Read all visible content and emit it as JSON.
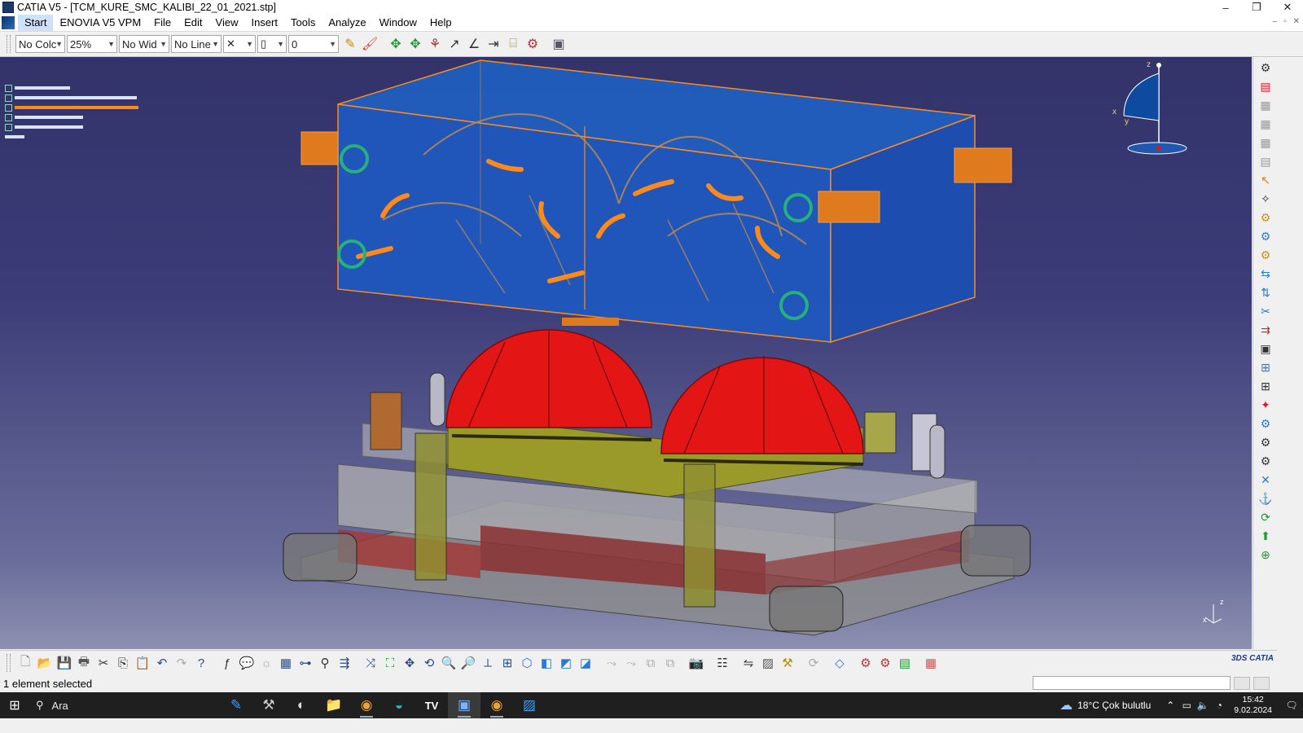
{
  "window": {
    "title": "CATIA V5 - [TCM_KURE_SMC_KALIBI_22_01_2021.stp]",
    "controls": {
      "minimize": "–",
      "restore": "❐",
      "close": "✕"
    }
  },
  "menubar": {
    "items": [
      "Start",
      "ENOVIA V5 VPM",
      "File",
      "Edit",
      "View",
      "Insert",
      "Tools",
      "Analyze",
      "Window",
      "Help"
    ],
    "mdi_controls": {
      "minimize": "–",
      "restore": "▫",
      "close": "✕"
    }
  },
  "graphic_properties": {
    "color": "No Colc",
    "transparency": "25%",
    "line_width": "No Wid",
    "line_type": "No Line",
    "point_symbol": "✕",
    "layer_symbol": "▯",
    "layer": "0"
  },
  "viewport": {
    "background_top": "#33336a",
    "background_bottom": "#8d90b0",
    "compass_labels": {
      "x": "x",
      "y": "y",
      "z": "z"
    },
    "triad_labels": {
      "z": "z",
      "x": "x"
    },
    "highlight_color": "#ff8a1a",
    "dome_color": "#e41515"
  },
  "status": {
    "message": "1 element selected"
  },
  "taskbar": {
    "search_placeholder": "Ara",
    "weather": "18°C  Çok bulutlu",
    "time": "15:42",
    "date": "9.02.2024"
  },
  "icons": {
    "top_toolbar": [
      "format-painter-icon",
      "color-brush-icon",
      "pan-icon",
      "move-compass-icon",
      "snap-icon",
      "measure-icon",
      "angle-icon",
      "distance-icon",
      "analysis-icon",
      "clash-icon",
      "photo-icon"
    ],
    "bottom_toolbar": [
      "new-icon",
      "open-icon",
      "save-icon",
      "print-icon",
      "cut-icon",
      "copy-icon",
      "paste-icon",
      "undo-icon",
      "redo-icon",
      "whats-this-icon",
      "formula-icon",
      "knowledge-icon",
      "table-icon",
      "graph-icon",
      "fit-all-icon",
      "pan-view-icon",
      "rotate-icon",
      "zoom-in-icon",
      "zoom-out-icon",
      "normal-view-icon",
      "iso-view-icon",
      "render-style-icon",
      "hide-show-icon",
      "swap-space-icon",
      "camera-icon",
      "catalog-icon",
      "grid-icon"
    ]
  }
}
